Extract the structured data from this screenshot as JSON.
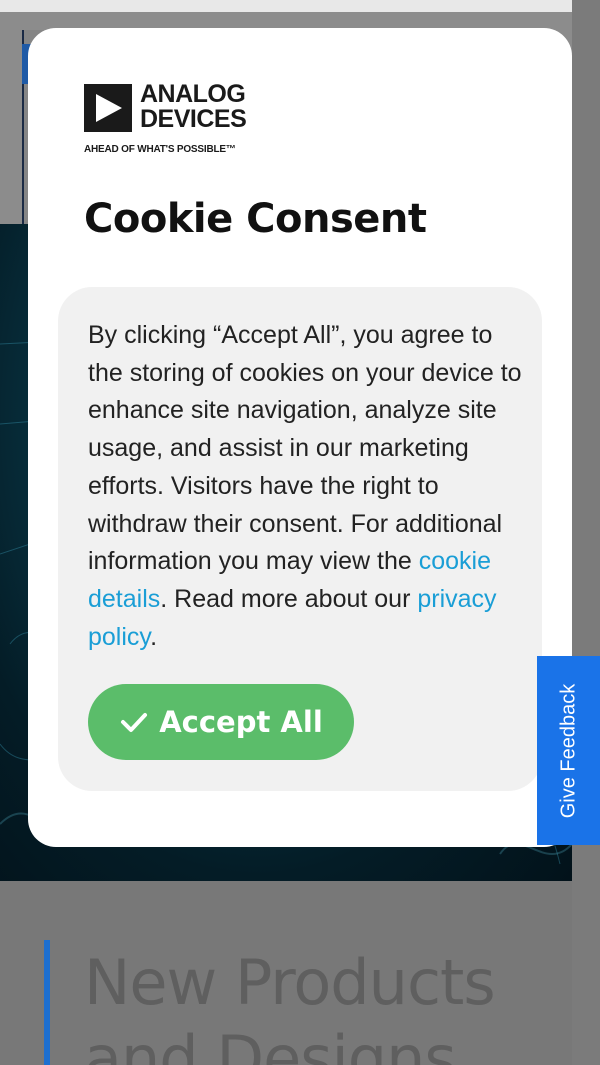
{
  "brand": {
    "name": "ANALOG\nDEVICES",
    "tagline": "AHEAD OF WHAT'S POSSIBLE™"
  },
  "consent": {
    "title": "Cookie Consent",
    "text_1": "By clicking “Accept All”, you agree to the storing of cookies on your device to enhance site navigation, analyze site usage, and assist in our marketing efforts. Visitors have the right to withdraw their consent. For additional information you may view the ",
    "cookie_link": "cookie details",
    "text_2": ". Read more about our ",
    "privacy_link": "privacy policy",
    "text_3": ".",
    "accept_label": "Accept All"
  },
  "feedback": {
    "label": "Give Feedback"
  },
  "background": {
    "heading": "New Products and Designs"
  },
  "colors": {
    "link": "#1a9ed6",
    "accept_button": "#5bbd6a",
    "feedback_tab": "#1a73e8",
    "accent_bar": "#1d6fd0"
  },
  "icons": {
    "logo": "analog-devices-logo-icon",
    "accept": "checkmark-icon"
  }
}
